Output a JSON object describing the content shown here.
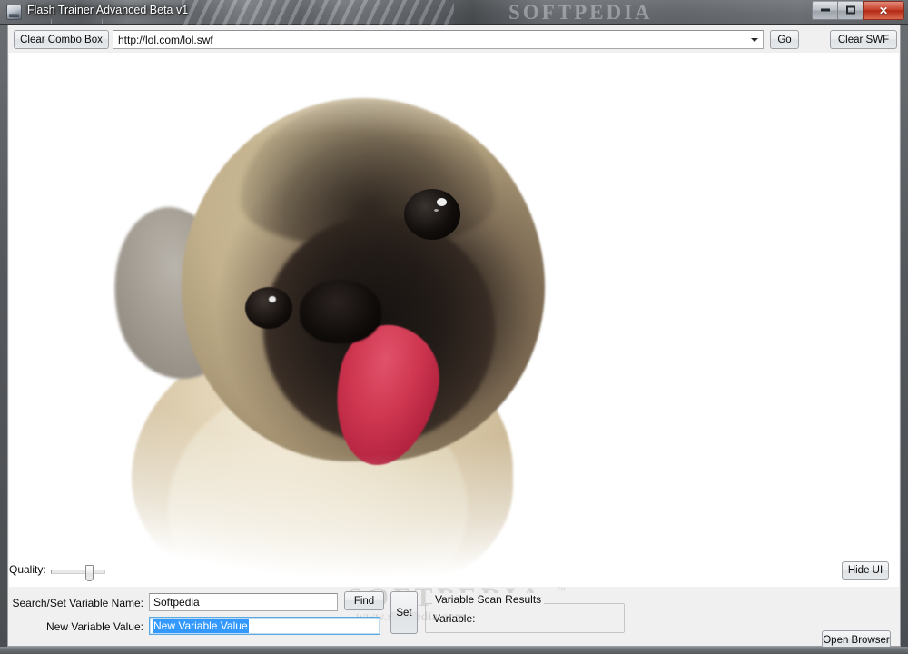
{
  "window": {
    "title": "Flash Trainer Advanced Beta v1",
    "app_icon": "flash-trainer-icon",
    "minimize_label": "",
    "maximize_label": "",
    "close_label": "✕",
    "watermark_title": "SOFTPEDIA"
  },
  "toolbar": {
    "clear_combo_label": "Clear Combo Box",
    "url_value": "http://lol.com/lol.swf",
    "url_placeholder": "",
    "go_label": "Go",
    "clear_swf_label": "Clear SWF"
  },
  "stage": {
    "content_description": "pug dog with tongue out"
  },
  "bottom": {
    "quality_label": "Quality:",
    "quality_value": "65",
    "hide_ui_label": "Hide UI",
    "search_label": "Search/Set Variable Name:",
    "search_value": "Softpedia",
    "new_value_label": "New Variable Value:",
    "new_value_value": "New Variable Value",
    "find_label": "Find",
    "set_label": "Set",
    "group_title": "Variable Scan Results",
    "group_item": "Variable:",
    "open_browser_label": "Open Browser"
  },
  "watermarks": {
    "big": "SOFTPEDIA",
    "tm": "™",
    "small": "www.softpedia.com"
  },
  "colors": {
    "accent_selection": "#3399ff",
    "window_chrome": "#55585c",
    "client_bg": "#f0f0f0",
    "close_button": "#c8422c"
  }
}
